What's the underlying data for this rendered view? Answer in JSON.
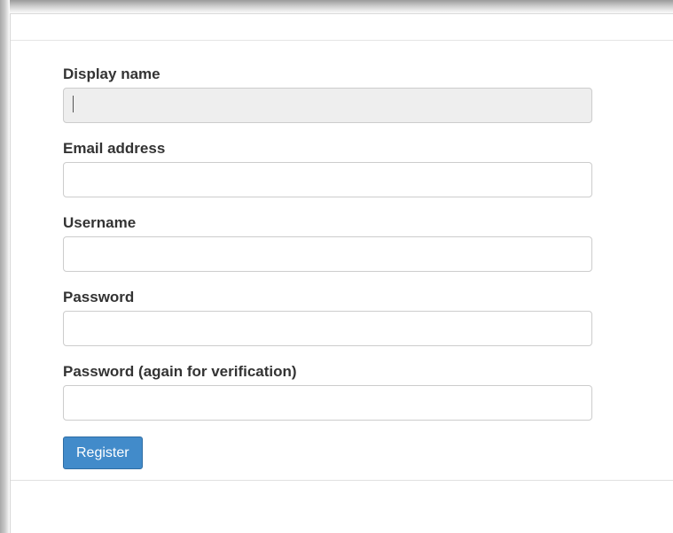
{
  "form": {
    "fields": [
      {
        "label": "Display name",
        "value": "",
        "placeholder": "",
        "disabled": true
      },
      {
        "label": "Email address",
        "value": "",
        "placeholder": ""
      },
      {
        "label": "Username",
        "value": "",
        "placeholder": ""
      },
      {
        "label": "Password",
        "value": "",
        "placeholder": ""
      },
      {
        "label": "Password (again for verification)",
        "value": "",
        "placeholder": ""
      }
    ],
    "submit_label": "Register"
  },
  "colors": {
    "primary_button": "#428bca",
    "primary_button_border": "#2e6da4",
    "disabled_input_bg": "#eeeeee",
    "label_text": "#333333"
  }
}
